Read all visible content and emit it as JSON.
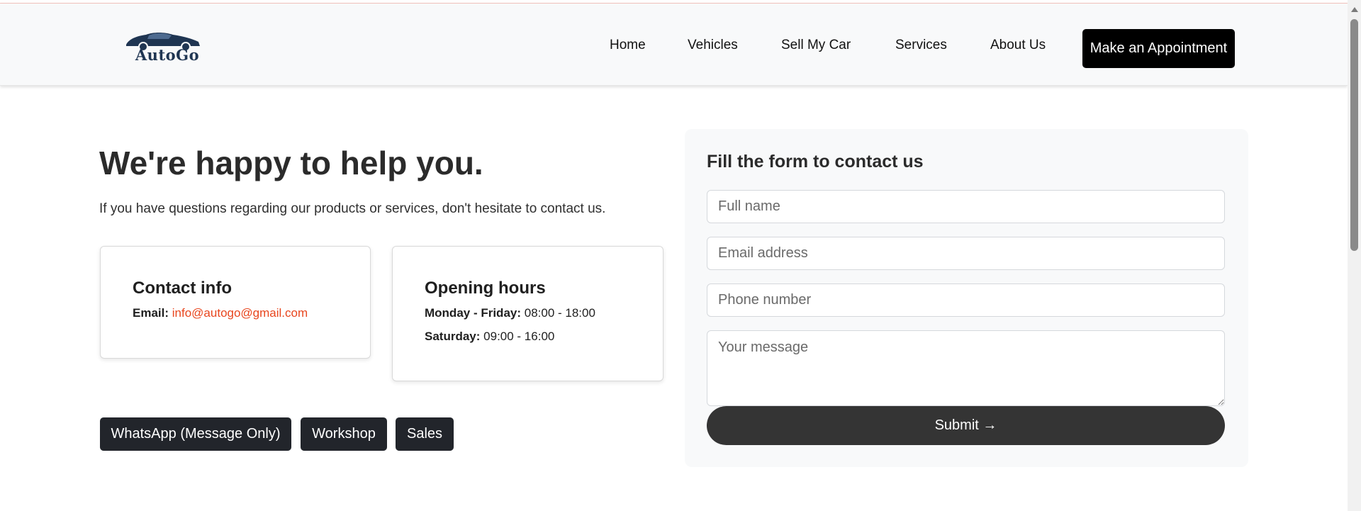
{
  "brand": {
    "logo_text": "AutoGo",
    "primary_color": "#1f3552"
  },
  "nav": {
    "items": [
      {
        "label": "Home"
      },
      {
        "label": "Vehicles"
      },
      {
        "label": "Sell My Car"
      },
      {
        "label": "Services"
      },
      {
        "label": "About Us"
      }
    ],
    "cta_label": "Make an Appointment"
  },
  "hero": {
    "headline": "We're happy to help you.",
    "subtext": "If you have questions regarding our products or services, don't hesitate to contact us."
  },
  "contact_card": {
    "title": "Contact info",
    "email_label": "Email:",
    "email_value": "info@autogo@gmail.com"
  },
  "hours_card": {
    "title": "Opening hours",
    "weekday_label": "Monday - Friday:",
    "weekday_hours": "08:00 - 18:00",
    "saturday_label": "Saturday:",
    "saturday_hours": "09:00 - 16:00"
  },
  "quick_buttons": [
    {
      "label": "WhatsApp (Message Only)"
    },
    {
      "label": "Workshop"
    },
    {
      "label": "Sales"
    }
  ],
  "form": {
    "title": "Fill the form to contact us",
    "full_name_placeholder": "Full name",
    "email_placeholder": "Email address",
    "phone_placeholder": "Phone number",
    "message_placeholder": "Your message",
    "submit_label": "Submit →"
  },
  "colors": {
    "accent_link": "#e8461e",
    "button_dark": "#22252b",
    "submit_bg": "#343434"
  }
}
